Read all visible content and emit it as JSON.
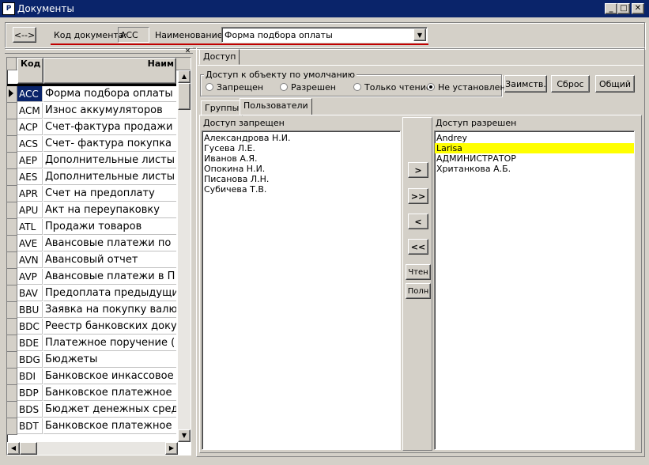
{
  "window": {
    "title": "Документы",
    "icon_text": "P"
  },
  "toolbar": {
    "swap_label": "<-->",
    "code_label": "Код документа:",
    "code_value": "ACC",
    "name_label": "Наименование:",
    "name_value": "Форма подбора оплаты"
  },
  "grid": {
    "col_code": "Код",
    "col_name": "Наим",
    "rows": [
      {
        "code": "ACC",
        "name": "Форма подбора оплаты",
        "selected": true
      },
      {
        "code": "ACM",
        "name": "Износ аккумуляторов"
      },
      {
        "code": "ACP",
        "name": "Счет-фактура продажи"
      },
      {
        "code": "ACS",
        "name": "Счет- фактура покупка"
      },
      {
        "code": "AEP",
        "name": "Дополнительные листы"
      },
      {
        "code": "AES",
        "name": "Дополнительные листы"
      },
      {
        "code": "APR",
        "name": "Счет на предоплату"
      },
      {
        "code": "APU",
        "name": "Акт на переупаковку"
      },
      {
        "code": "ATL",
        "name": "Продажи товаров"
      },
      {
        "code": "AVE",
        "name": "Авансовые платежи по"
      },
      {
        "code": "AVN",
        "name": "Авансовый отчет"
      },
      {
        "code": "AVP",
        "name": "Авансовые платежи в П"
      },
      {
        "code": "BAV",
        "name": "Предоплата предыдущи"
      },
      {
        "code": "BBU",
        "name": "Заявка на покупку валю"
      },
      {
        "code": "BDC",
        "name": "Реестр банковских доку"
      },
      {
        "code": "BDE",
        "name": "Платежное поручение ("
      },
      {
        "code": "BDG",
        "name": "Бюджеты"
      },
      {
        "code": "BDI",
        "name": "Банковское инкассовое"
      },
      {
        "code": "BDP",
        "name": "Банковское платежное"
      },
      {
        "code": "BDS",
        "name": "Бюджет денежных средс"
      },
      {
        "code": "BDT",
        "name": "Банковское платежное"
      }
    ]
  },
  "access": {
    "tab_label": "Доступ",
    "default_group_label": "Доступ к объекту по умолчанию",
    "radios": [
      {
        "label": "Запрещен",
        "checked": false
      },
      {
        "label": "Разрешен",
        "checked": false
      },
      {
        "label": "Только чтение",
        "checked": false
      },
      {
        "label": "Не установлен",
        "checked": true
      }
    ],
    "buttons": {
      "borrow": "Заимств.",
      "reset": "Сброс",
      "common": "Общий"
    },
    "subtabs": {
      "groups": "Группы",
      "users": "Пользователи"
    },
    "denied_header": "Доступ запрещен",
    "allowed_header": "Доступ разрешен",
    "denied": [
      "Александрова Н.И.",
      "Гусева Л.Е.",
      "Иванов А.Я.",
      "Опокина Н.И.",
      "Писанова Л.Н.",
      "Субичева Т.В."
    ],
    "allowed": [
      {
        "name": "Andrey",
        "highlight": false
      },
      {
        "name": "Larisa",
        "highlight": true
      },
      {
        "name": "АДМИНИСТРАТОР",
        "highlight": false
      },
      {
        "name": "Хританкова А.Б.",
        "highlight": false
      }
    ],
    "move": {
      "one_right": ">",
      "all_right": ">>",
      "one_left": "<",
      "all_left": "<<",
      "read": "Чтен",
      "full": "Полн"
    }
  }
}
